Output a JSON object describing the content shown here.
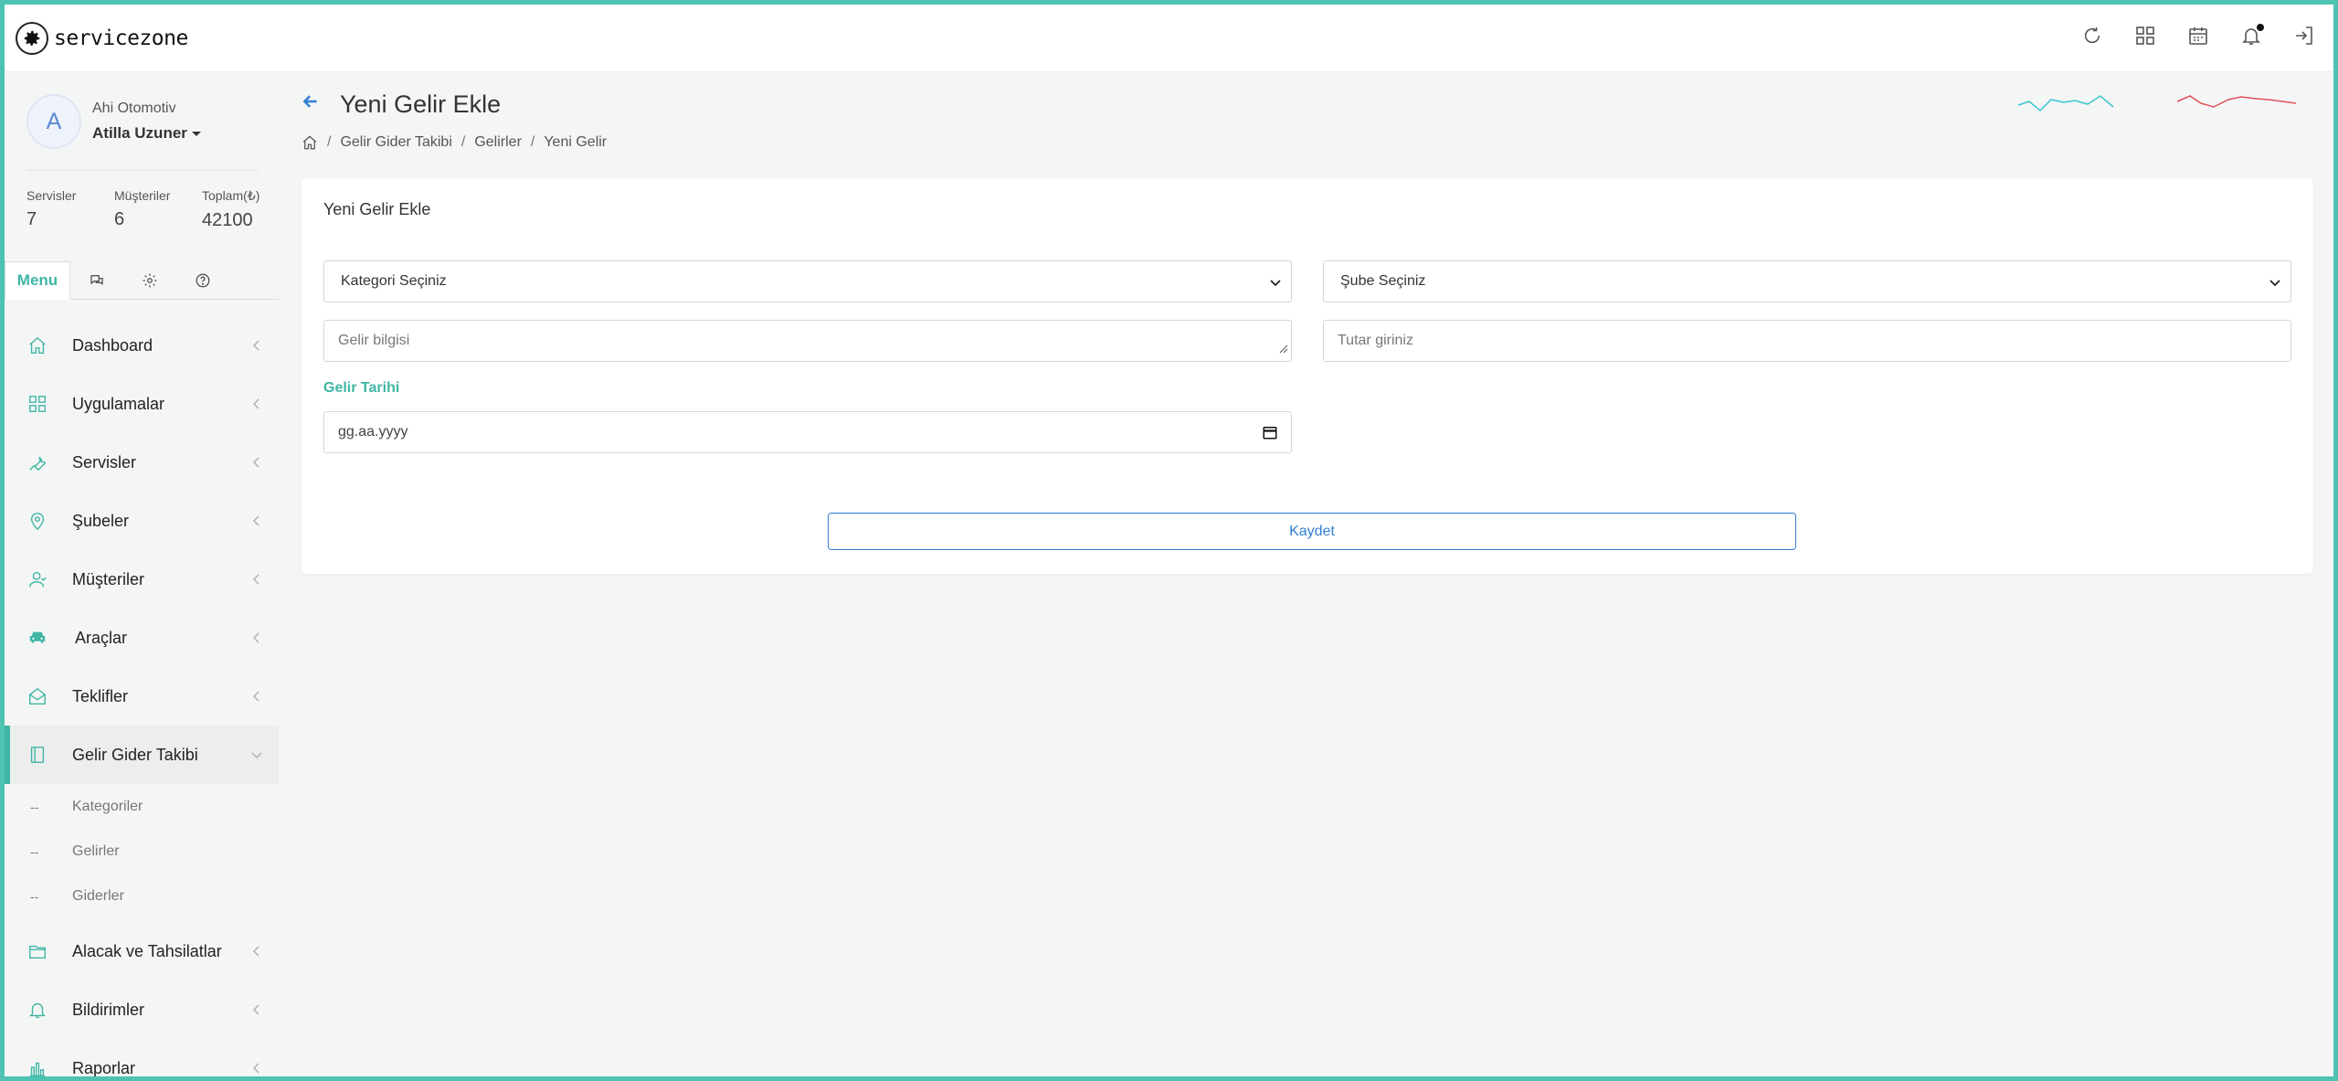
{
  "app": {
    "logo_text": "servicezone"
  },
  "user": {
    "avatar_letter": "A",
    "company": "Ahi Otomotiv",
    "name": "Atilla Uzuner"
  },
  "stats": [
    {
      "label": "Servisler",
      "value": "7"
    },
    {
      "label": "Müşteriler",
      "value": "6"
    },
    {
      "label": "Toplam(₺)",
      "value": "42100"
    }
  ],
  "tabs": {
    "menu_label": "Menu"
  },
  "menu": {
    "items": [
      {
        "label": "Dashboard",
        "icon": "home-icon"
      },
      {
        "label": "Uygulamalar",
        "icon": "grid-icon"
      },
      {
        "label": "Servisler",
        "icon": "wrench-icon"
      },
      {
        "label": "Şubeler",
        "icon": "map-pin-icon"
      },
      {
        "label": "Müşteriler",
        "icon": "users-icon"
      },
      {
        "label": "Araçlar",
        "icon": "car-icon"
      },
      {
        "label": "Teklifler",
        "icon": "mail-open-icon"
      },
      {
        "label": "Gelir Gider Takibi",
        "icon": "book-icon"
      },
      {
        "label": "Alacak ve Tahsilatlar",
        "icon": "folder-icon"
      },
      {
        "label": "Bildirimler",
        "icon": "bell-icon"
      },
      {
        "label": "Raporlar",
        "icon": "bar-chart-icon"
      }
    ],
    "submenu": [
      {
        "dash": "--",
        "label": "Kategoriler"
      },
      {
        "dash": "--",
        "label": "Gelirler"
      },
      {
        "dash": "--",
        "label": "Giderler"
      }
    ]
  },
  "page": {
    "title": "Yeni Gelir Ekle",
    "breadcrumb": [
      "Gelir Gider Takibi",
      "Gelirler",
      "Yeni Gelir"
    ],
    "breadcrumb_sep": "/"
  },
  "form": {
    "card_title": "Yeni Gelir Ekle",
    "category_select": "Kategori Seçiniz",
    "branch_select": "Şube Seçiniz",
    "info_placeholder": "Gelir bilgisi",
    "amount_placeholder": "Tutar giriniz",
    "date_label": "Gelir Tarihi",
    "date_placeholder": "gg.aa.yyyy",
    "save_label": "Kaydet"
  },
  "colors": {
    "accent": "#3fb5a4",
    "primary": "#2f7fd3",
    "spark_1": "#3cc3cf",
    "spark_2": "#e0505a"
  }
}
